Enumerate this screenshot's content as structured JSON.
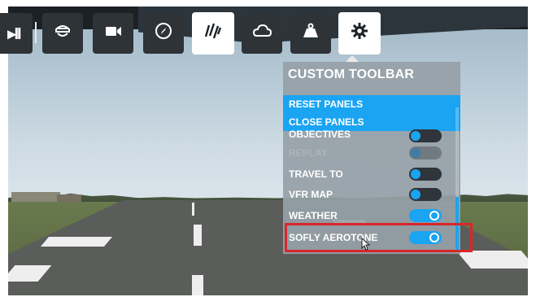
{
  "toolbar": {
    "buttons": [
      {
        "name": "pause-button",
        "icon": "pause-icon",
        "glyph": "▸II",
        "active": false
      },
      {
        "name": "pilot-button",
        "icon": "pilot-cap-icon",
        "active": false
      },
      {
        "name": "camera-button",
        "icon": "video-camera-icon",
        "active": false
      },
      {
        "name": "navlog-button",
        "icon": "compass-icon",
        "active": false
      },
      {
        "name": "atc-button",
        "icon": "atc-waves-icon",
        "active": true
      },
      {
        "name": "weather-button",
        "icon": "cloud-icon",
        "active": false
      },
      {
        "name": "weight-button",
        "icon": "weight-icon",
        "active": false
      },
      {
        "name": "settings-button",
        "icon": "gear-icon",
        "active": true
      }
    ]
  },
  "panel": {
    "title": "CUSTOM TOOLBAR",
    "actions": [
      {
        "label": "RESET PANELS"
      },
      {
        "label": "CLOSE PANELS"
      }
    ],
    "rows": [
      {
        "label": "OBJECTIVES",
        "state": "off"
      },
      {
        "label": "REPLAY",
        "state": "disabled"
      },
      {
        "label": "TRAVEL TO",
        "state": "off"
      },
      {
        "label": "VFR MAP",
        "state": "off"
      },
      {
        "label": "WEATHER",
        "state": "on"
      },
      {
        "label": "SOFLY AEROTONE",
        "state": "on"
      }
    ]
  },
  "colors": {
    "accent": "#1aa4f2",
    "highlight_box": "#d9262a",
    "panel_bg": "#96a0a8"
  }
}
